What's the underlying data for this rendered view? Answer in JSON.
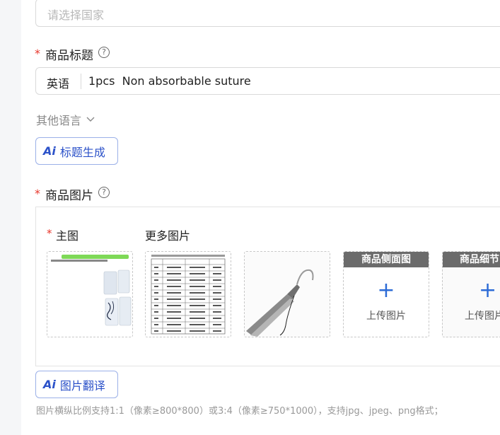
{
  "country": {
    "placeholder": "请选择国家"
  },
  "title_section": {
    "required_mark": "*",
    "label": "商品标题",
    "help": "?",
    "lang": "英语",
    "value": "1pcs  Non absorbable suture",
    "other_languages": "其他语言",
    "ai_button_logo": "Ai",
    "ai_button_label": "标题生成"
  },
  "images_section": {
    "required_mark": "*",
    "label": "商品图片",
    "help": "?",
    "main_required_mark": "*",
    "main_label": "主图",
    "more_label": "更多图片",
    "upload_slots": [
      {
        "head": "商品侧面图",
        "text": "上传图片"
      },
      {
        "head": "商品细节",
        "text": "上传图片"
      }
    ],
    "ai_button_logo": "Ai",
    "ai_button_label": "图片翻译",
    "hint": "图片横纵比例支持1:1（像素≥800*800）或3:4（像素≥750*1000），支持jpg、jpeg、png格式；"
  },
  "colors": {
    "accent": "#2c52c9",
    "required": "#e8362b",
    "plus": "#2c6bd6"
  },
  "icons": {
    "help": "question-circle-icon",
    "chevron": "chevron-down-icon",
    "plus": "plus-icon"
  }
}
